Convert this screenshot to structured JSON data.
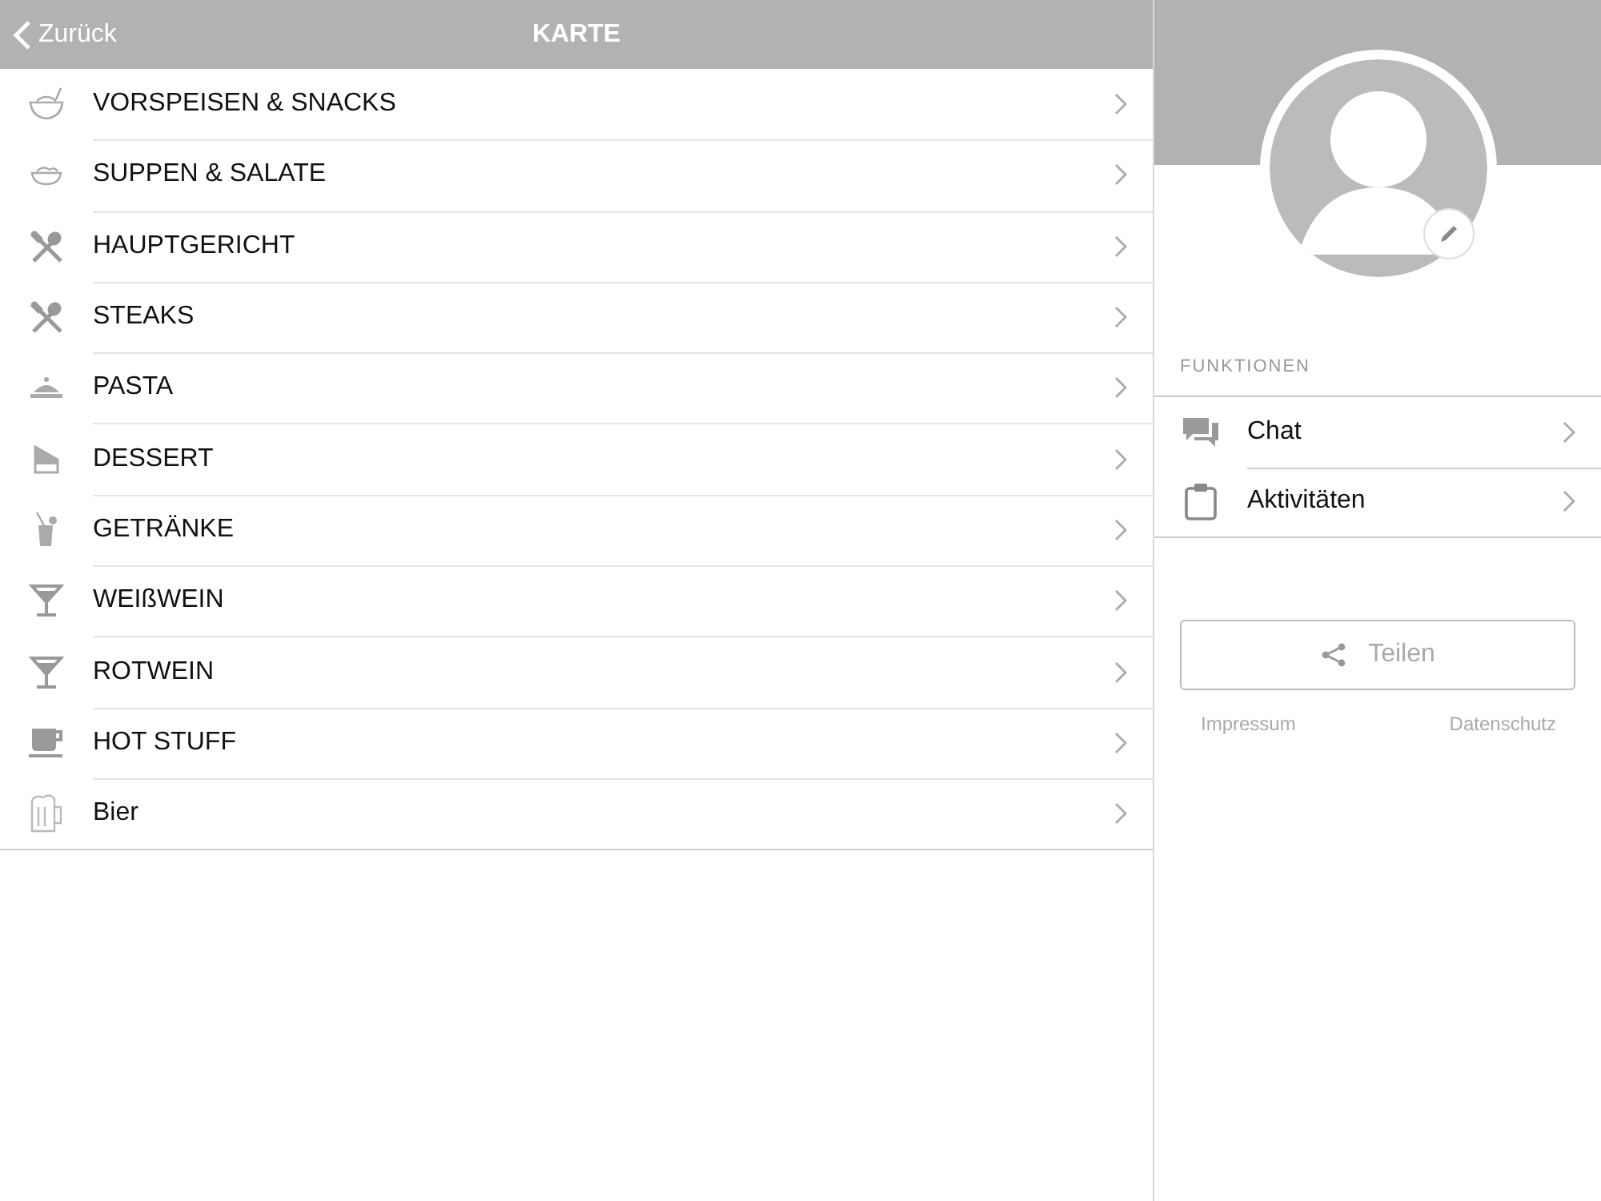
{
  "nav_bar": {
    "back": "Zurück",
    "title": "KARTE"
  },
  "menu": [
    {
      "label": "VORSPEISEN & SNACKS",
      "kind": "bowl"
    },
    {
      "label": "SUPPEN & SALATE",
      "kind": "soup"
    },
    {
      "label": "HAUPTGERICHT",
      "kind": "cutlery"
    },
    {
      "label": "STEAKS",
      "kind": "cutlery"
    },
    {
      "label": "PASTA",
      "kind": "pasta"
    },
    {
      "label": "DESSERT",
      "kind": "cake"
    },
    {
      "label": "GETRÄNKE",
      "kind": "drink"
    },
    {
      "label": "WEIßWEIN",
      "kind": "glass"
    },
    {
      "label": "ROTWEIN",
      "kind": "glass"
    },
    {
      "label": "HOT STUFF",
      "kind": "cup"
    },
    {
      "label": "Bier",
      "kind": "beer"
    }
  ],
  "side": {
    "section": "FUNKTIONEN",
    "items": [
      {
        "label": "Chat",
        "kind": "chat"
      },
      {
        "label": "Aktivitäten",
        "kind": "clipboard"
      }
    ],
    "share": "Teilen",
    "links": [
      "Impressum",
      "Datenschutz"
    ]
  }
}
